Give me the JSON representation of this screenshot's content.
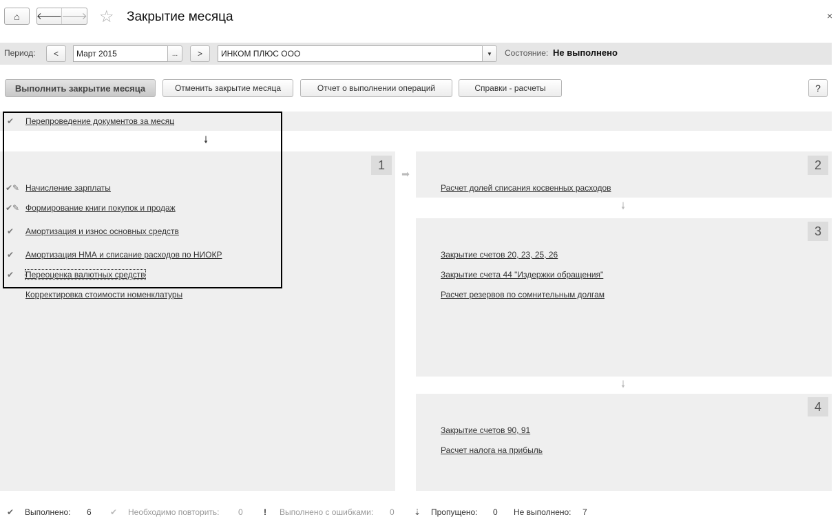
{
  "header": {
    "title": "Закрытие месяца",
    "close": "×"
  },
  "period": {
    "label": "Период:",
    "prev": "<",
    "value": "Март 2015",
    "select": "...",
    "next": ">",
    "organization": "ИНКОМ ПЛЮС ООО",
    "state_label": "Состояние:",
    "state_value": "Не выполнено"
  },
  "toolbar": {
    "run": "Выполнить закрытие месяца",
    "cancel": "Отменить закрытие месяца",
    "report": "Отчет о выполнении операций",
    "references": "Справки - расчеты",
    "help": "?"
  },
  "top_item": {
    "label": "Перепроведение документов за месяц",
    "status": "done"
  },
  "panels": [
    {
      "number": "1",
      "items": [
        {
          "label": "Начисление зарплаты",
          "status": "done-edited"
        },
        {
          "label": "Формирование книги покупок и продаж",
          "status": "done-edited"
        },
        {
          "label": "Амортизация и износ основных средств",
          "status": "done"
        },
        {
          "label": "Амортизация НМА и списание расходов по НИОКР",
          "status": "done"
        },
        {
          "label": "Переоценка валютных средств",
          "status": "done"
        },
        {
          "label": "Корректировка стоимости номенклатуры",
          "status": "none"
        }
      ]
    },
    {
      "number": "2",
      "items": [
        {
          "label": "Расчет долей списания косвенных расходов"
        }
      ]
    },
    {
      "number": "3",
      "items": [
        {
          "label": "Закрытие счетов 20, 23, 25, 26"
        },
        {
          "label": "Закрытие счета 44 \"Издержки обращения\""
        },
        {
          "label": "Расчет резервов по сомнительным долгам"
        }
      ]
    },
    {
      "number": "4",
      "items": [
        {
          "label": "Закрытие счетов 90, 91"
        },
        {
          "label": "Расчет налога на прибыль"
        }
      ]
    }
  ],
  "footer": {
    "done_label": "Выполнено:",
    "done": "6",
    "repeat_label": "Необходимо повторить:",
    "repeat": "0",
    "errors_label": "Выполнено с ошибками:",
    "errors": "0",
    "skipped_label": "Пропущено:",
    "skipped": "0",
    "notdone_label": "Не выполнено:",
    "notdone": "7"
  }
}
